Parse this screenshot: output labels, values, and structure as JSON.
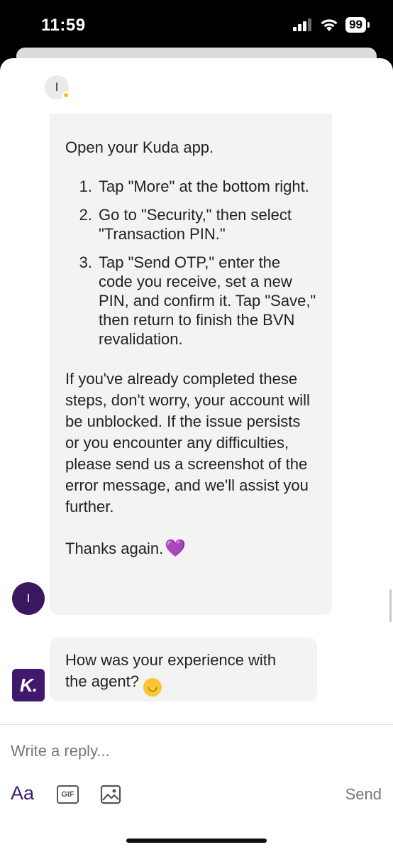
{
  "status": {
    "time": "11:59",
    "battery": "99"
  },
  "chat": {
    "top_avatar_initial": "I",
    "agent_message": {
      "intro": "Open your Kuda app.",
      "steps": [
        {
          "num": "1.",
          "text": "Tap \"More\" at the bottom right."
        },
        {
          "num": "2.",
          "text": "Go to \"Security,\" then select \"Transaction PIN.\""
        },
        {
          "num": "3.",
          "text": "Tap \"Send OTP,\" enter the code you receive, set a new PIN, and confirm it. Tap \"Save,\" then return to finish the BVN revalidation."
        }
      ],
      "body": "If you've already completed these steps, don't worry, your account will be unblocked. If the issue persists or you encounter any difficulties, please send us a screenshot of the error message, and we'll assist you further.",
      "thanks": "Thanks again.",
      "thanks_emoji": "💜"
    },
    "user_avatar_initial": "I",
    "rating_message": {
      "text": "How was your experience with the agent?",
      "emoji": "🙂"
    },
    "kuda_logo": "K."
  },
  "composer": {
    "placeholder": "Write a reply...",
    "font_label": "Aa",
    "gif_label": "GIF",
    "send_label": "Send"
  },
  "colors": {
    "brand": "#40196d",
    "bubble": "#f3f3f3",
    "accent_dot": "#f5c211"
  }
}
